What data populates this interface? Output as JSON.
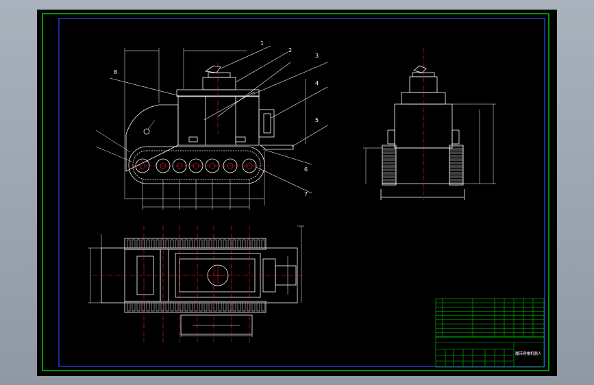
{
  "drawing": {
    "part_labels": [
      "1",
      "2",
      "3",
      "4",
      "5",
      "6",
      "7",
      "8"
    ],
    "title_block": {
      "name": "履带爬楼机器人"
    }
  },
  "colors": {
    "background": "#000000",
    "border_outer": "#00c800",
    "border_inner": "#2b36c8",
    "line": "#ffffff",
    "centerline": "#ff2020",
    "dimension": "#ffffff",
    "table_line": "#00c800",
    "title_text": "#00ffff"
  }
}
